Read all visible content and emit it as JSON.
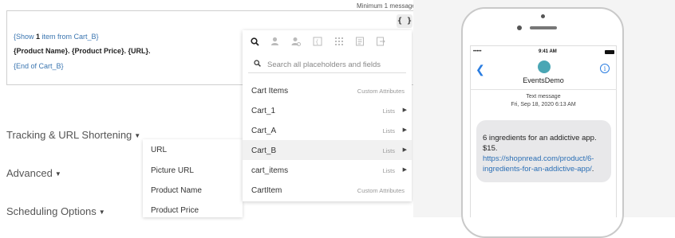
{
  "editor": {
    "min_message": "Minimum 1 message",
    "placeholder_button": "{ }",
    "line1_prefix": "{Show ",
    "line1_count": "1",
    "line1_suffix": " item from Cart_B}",
    "line2": "{Product Name}. {Product Price}. {URL}.",
    "line3": "{End of Cart_B}"
  },
  "sections": {
    "tracking": "Tracking & URL Shortening",
    "advanced": "Advanced",
    "scheduling": "Scheduling Options"
  },
  "fields_menu": [
    "URL",
    "Picture URL",
    "Product Name",
    "Product Price"
  ],
  "dropdown": {
    "search_placeholder": "Search all placeholders and fields",
    "rows": [
      {
        "name": "Cart Items",
        "type": "Custom Attributes",
        "arrow": false
      },
      {
        "name": "Cart_1",
        "type": "Lists",
        "arrow": true
      },
      {
        "name": "Cart_A",
        "type": "Lists",
        "arrow": true
      },
      {
        "name": "Cart_B",
        "type": "Lists",
        "arrow": true
      },
      {
        "name": "cart_items",
        "type": "Lists",
        "arrow": true
      },
      {
        "name": "CartItem",
        "type": "Custom Attributes",
        "arrow": false
      }
    ]
  },
  "phone": {
    "status_signal": "•••••",
    "status_time": "9:41 AM",
    "contact": "EventsDemo",
    "message_type": "Text message",
    "message_date": "Fri, Sep 18, 2020 6:13 AM",
    "bubble_text": "6 ingredients for an addictive app.",
    "bubble_price": "$15.",
    "bubble_link": "https://shopnread.com/product/6-ingredients-for-an-addictive-app/",
    "bubble_tail": "."
  },
  "colors": {
    "link": "#3a75b0",
    "accent": "#2a7de1",
    "avatar": "#4aa6b4"
  }
}
